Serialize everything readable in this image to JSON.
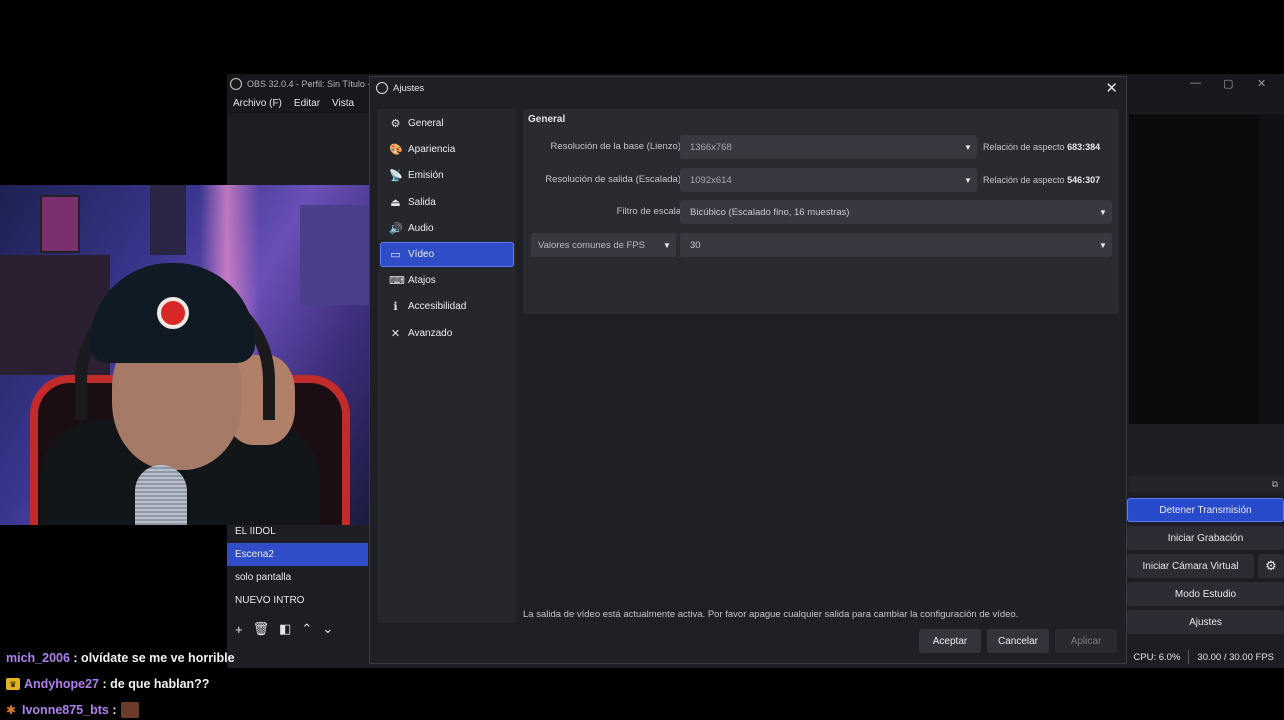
{
  "obs_main": {
    "title": "OBS 32.0.4 - Perfil: Sin Título -",
    "menu": [
      "Archivo (F)",
      "Editar",
      "Vista"
    ],
    "window_controls": [
      "—",
      "▢",
      "✕"
    ],
    "scenes": [
      {
        "label": "EL IIDOL",
        "active": false
      },
      {
        "label": "Escena2",
        "active": true
      },
      {
        "label": "solo pantalla",
        "active": false
      },
      {
        "label": "NUEVO INTRO",
        "active": false
      }
    ],
    "controls": {
      "stop_stream": "Detener Transmisión",
      "start_record": "Iniciar Grabación",
      "start_vcam": "Iniciar Cámara Virtual",
      "studio_mode": "Modo Estudio",
      "settings": "Ajustes"
    },
    "status": {
      "cpu": "CPU: 6.0%",
      "fps": "30.00 / 30.00 FPS"
    }
  },
  "dialog": {
    "title": "Ajustes",
    "sidebar": [
      {
        "label": "General",
        "icon": "gear-icon",
        "glyph": "⚙",
        "active": false
      },
      {
        "label": "Apariencia",
        "icon": "palette-icon",
        "glyph": "🎨",
        "active": false
      },
      {
        "label": "Emisión",
        "icon": "broadcast-icon",
        "glyph": "📡",
        "active": false
      },
      {
        "label": "Salida",
        "icon": "output-icon",
        "glyph": "⏏",
        "active": false
      },
      {
        "label": "Audio",
        "icon": "speaker-icon",
        "glyph": "🔊",
        "active": false
      },
      {
        "label": "Vídeo",
        "icon": "monitor-icon",
        "glyph": "▭",
        "active": true
      },
      {
        "label": "Atajos",
        "icon": "keyboard-icon",
        "glyph": "⌨",
        "active": false
      },
      {
        "label": "Accesibilidad",
        "icon": "accessibility-icon",
        "glyph": "ℹ",
        "active": false
      },
      {
        "label": "Avanzado",
        "icon": "wrench-icon",
        "glyph": "✕",
        "active": false
      }
    ],
    "group_title": "General",
    "base_resolution": {
      "label": "Resolución de la base (Lienzo)",
      "value": "1366x768",
      "aspect_label": "Relación de aspecto",
      "aspect_value": "683:384"
    },
    "output_resolution": {
      "label": "Resolución de salida (Escalada)",
      "value": "1092x614",
      "aspect_label": "Relación de aspecto",
      "aspect_value": "546:307"
    },
    "scale_filter": {
      "label": "Filtro de escala",
      "value": "Bicúbico (Escalado fino, 16 muestras)"
    },
    "fps": {
      "mode": "Valores comunes de FPS",
      "value": "30"
    },
    "notice": "La salida de vídeo está actualmente activa. Por favor apague cualquier salida para cambiar la configuración de vídeo.",
    "buttons": {
      "accept": "Aceptar",
      "cancel": "Cancelar",
      "apply": "Aplicar"
    }
  },
  "chat": [
    {
      "user": "mich_2006",
      "message": ": olvídate se me ve horrible",
      "badge": ""
    },
    {
      "user": "Andyhope27",
      "message": ": de que hablan??",
      "badge": "crown"
    },
    {
      "user": "Ivonne875_bts",
      "message": ":",
      "badge": "figure"
    }
  ],
  "colors": {
    "accent": "#2e4dc7",
    "chat_username": "#b07ef0",
    "dialog_bg": "#1f2025"
  }
}
